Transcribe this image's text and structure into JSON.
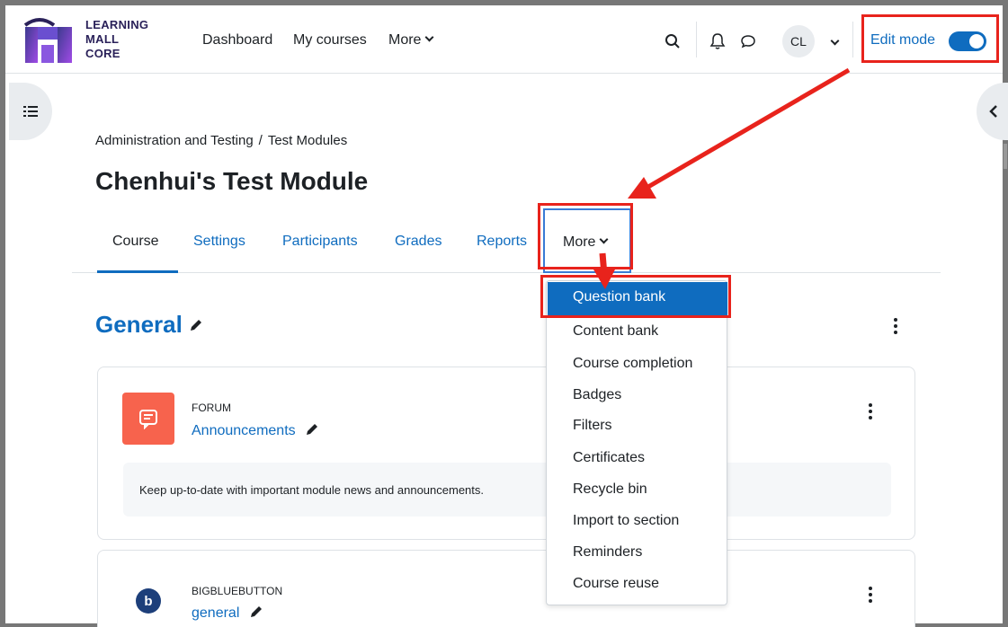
{
  "brand": {
    "line1": "LEARNING",
    "line2": "MALL",
    "line3": "CORE",
    "color": "#7b3fe4"
  },
  "topnav": {
    "dashboard": "Dashboard",
    "my_courses": "My courses",
    "more": "More"
  },
  "user": {
    "initials": "CL"
  },
  "edit_mode": {
    "label": "Edit mode",
    "enabled": true
  },
  "breadcrumb": {
    "items": [
      "Administration and Testing",
      "Test Modules"
    ],
    "separator": "/"
  },
  "page": {
    "title": "Chenhui's Test Module"
  },
  "tabs": {
    "items": [
      "Course",
      "Settings",
      "Participants",
      "Grades",
      "Reports"
    ],
    "more": "More",
    "active": "Course"
  },
  "section": {
    "title": "General"
  },
  "activities": [
    {
      "type": "FORUM",
      "name": "Announcements",
      "description": "Keep up-to-date with important module news and announcements.",
      "icon_color": "#f7634d"
    },
    {
      "type": "BIGBLUEBUTTON",
      "name": "general",
      "icon_color": "#1d3f7a"
    }
  ],
  "more_menu": {
    "items": [
      "Question bank",
      "Content bank",
      "Course completion",
      "Badges",
      "Filters",
      "Certificates",
      "Recycle bin",
      "Import to section",
      "Reminders",
      "Course reuse"
    ],
    "highlighted": "Question bank"
  },
  "colors": {
    "accent": "#0f6cbf",
    "annotation": "#e8231c"
  }
}
